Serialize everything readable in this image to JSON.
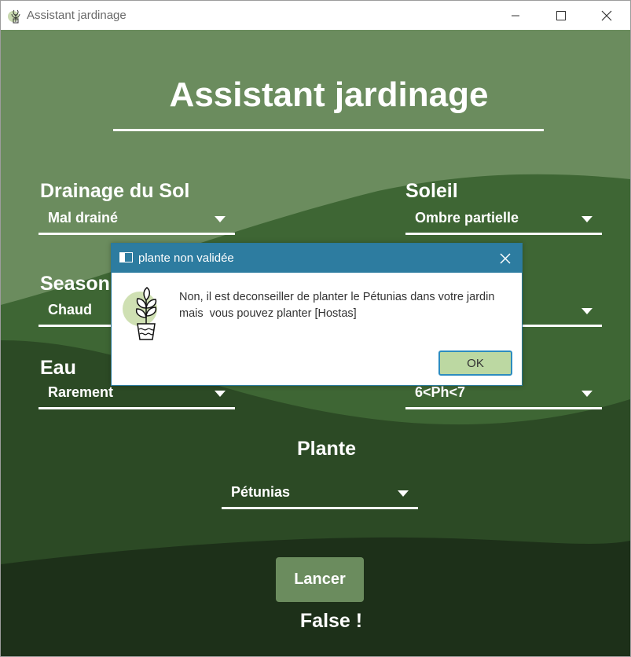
{
  "window": {
    "title": "Assistant jardinage"
  },
  "header": {
    "title": "Assistant jardinage"
  },
  "fields": {
    "drainage": {
      "label": "Drainage du Sol",
      "value": "Mal drainé"
    },
    "soleil": {
      "label": "Soleil",
      "value": "Ombre partielle"
    },
    "season": {
      "label": "Season",
      "value": "Chaud"
    },
    "right_middle": {
      "label": "",
      "value": ""
    },
    "eau": {
      "label": "Eau",
      "value": "Rarement"
    },
    "ph": {
      "label": "",
      "value": "6<Ph<7"
    },
    "plante": {
      "label": "Plante",
      "value": "Pétunias"
    }
  },
  "actions": {
    "launch_label": "Lancer",
    "result_text": "False !"
  },
  "dialog": {
    "title": "plante non validée",
    "message": "Non, il est deconseiller de planter le Pétunias dans votre jardin\nmais  vous pouvez planter [Hostas]",
    "ok_label": "OK"
  },
  "colors": {
    "bg_light": "#6b8c5e",
    "bg_mid": "#3e6634",
    "bg_dark": "#2c4a25",
    "bg_darkest": "#1d3019",
    "dialog_title": "#2d7ca0",
    "ok_button": "#bcd8a2"
  }
}
